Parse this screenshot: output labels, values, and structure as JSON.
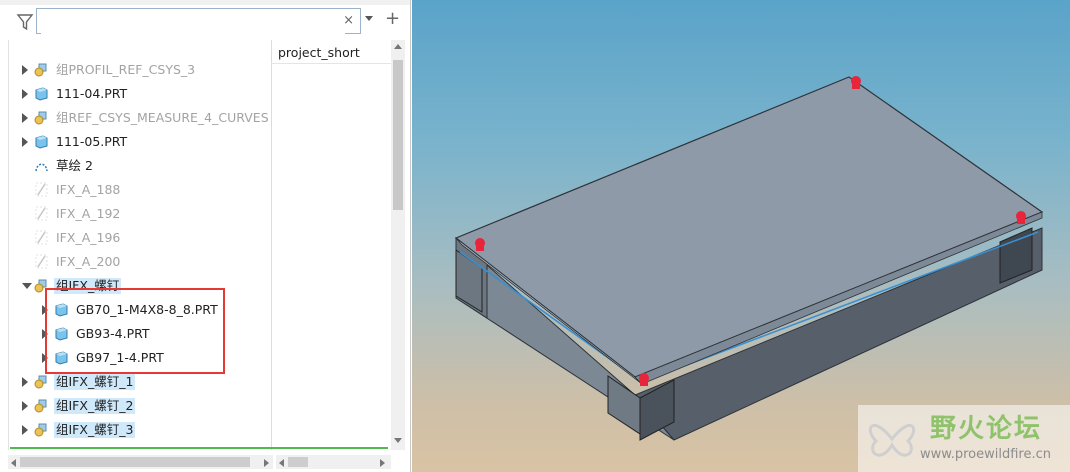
{
  "filter": {
    "placeholder": "",
    "value": "",
    "clear_symbol": "×",
    "add_symbol": "+",
    "icon": "funnel-icon"
  },
  "column_header": "project_short",
  "tree": [
    {
      "label": "组PROFIL_REF_CSYS_3",
      "dim": true,
      "icon": "group-icon"
    },
    {
      "label": "111-04.PRT",
      "dim": false,
      "icon": "part-icon"
    },
    {
      "label": "组REF_CSYS_MEASURE_4_CURVES",
      "dim": true,
      "icon": "group-icon"
    },
    {
      "label": "111-05.PRT",
      "dim": false,
      "icon": "part-icon"
    },
    {
      "label": "草绘 2",
      "dim": false,
      "icon": "sketch-icon"
    },
    {
      "label": "IFX_A_188",
      "dim": true,
      "icon": "datum-curve-icon"
    },
    {
      "label": "IFX_A_192",
      "dim": true,
      "icon": "datum-curve-icon"
    },
    {
      "label": "IFX_A_196",
      "dim": true,
      "icon": "datum-curve-icon"
    },
    {
      "label": "IFX_A_200",
      "dim": true,
      "icon": "datum-curve-icon"
    },
    {
      "label": "组IFX_螺钉",
      "dim": false,
      "icon": "group-icon",
      "highlight": true,
      "expanded": true
    },
    {
      "label": "GB70_1-M4X8-8_8.PRT",
      "dim": false,
      "icon": "part-icon",
      "child": true
    },
    {
      "label": "GB93-4.PRT",
      "dim": false,
      "icon": "part-icon",
      "child": true
    },
    {
      "label": "GB97_1-4.PRT",
      "dim": false,
      "icon": "part-icon",
      "child": true
    },
    {
      "label": "组IFX_螺钉_1",
      "dim": false,
      "icon": "group-icon",
      "highlight": true
    },
    {
      "label": "组IFX_螺钉_2",
      "dim": false,
      "icon": "group-icon",
      "highlight": true
    },
    {
      "label": "组IFX_螺钉_3",
      "dim": false,
      "icon": "group-icon",
      "highlight": true
    }
  ],
  "watermark": {
    "title": "野火论坛",
    "url": "www.proewildfire.cn"
  },
  "colors": {
    "selection": "#cfe8fa",
    "annotation_box": "#e53935",
    "part_icon": "#4aa3d8",
    "screw_marker": "#e8253a"
  }
}
